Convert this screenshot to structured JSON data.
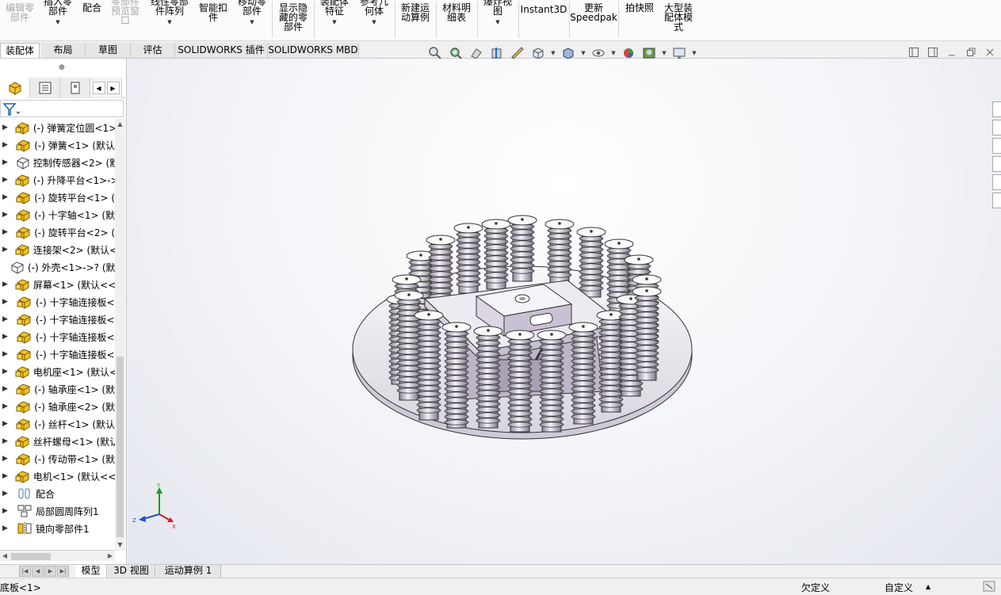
{
  "ribbon": {
    "buttons": [
      {
        "label": "编辑零\n部件",
        "disabled": true
      },
      {
        "label": "插入零\n部件"
      },
      {
        "label": "配合"
      },
      {
        "label": "零部件\n预览窗\n口",
        "disabled": true
      },
      {
        "label": "线性零部\n件阵列"
      },
      {
        "label": "智能扣\n件"
      },
      {
        "label": "移动零\n部件"
      },
      {
        "label": "显示隐\n藏的零\n部件"
      },
      {
        "label": "装配体\n特征"
      },
      {
        "label": "参考几\n何体"
      },
      {
        "label": "新建运\n动算例"
      },
      {
        "label": "材料明\n细表"
      },
      {
        "label": "爆炸视\n图"
      },
      {
        "label": "Instant3D"
      },
      {
        "label": "更新\nSpeedpak"
      },
      {
        "label": "拍快照"
      },
      {
        "label": "大型装\n配体模\n式"
      }
    ]
  },
  "command_tabs": [
    "装配体",
    "布局",
    "草图",
    "评估",
    "SOLIDWORKS 插件",
    "SOLIDWORKS MBD"
  ],
  "feature_tree": {
    "items": [
      {
        "label": "(-) 弹簧定位圆<1>",
        "icon": "part-icon"
      },
      {
        "label": "(-) 弹簧<1> (默认",
        "icon": "part-icon"
      },
      {
        "label": "控制传感器<2> (默",
        "icon": "part-outline-icon"
      },
      {
        "label": "(-) 升降平台<1>->",
        "icon": "part-icon"
      },
      {
        "label": "(-) 旋转平台<1> (",
        "icon": "part-icon"
      },
      {
        "label": "(-) 十字轴<1> (默",
        "icon": "part-icon"
      },
      {
        "label": "(-) 旋转平台<2> (",
        "icon": "part-icon"
      },
      {
        "label": "连接架<2> (默认<",
        "icon": "part-icon"
      },
      {
        "label": "(-) 外壳<1>->? (默",
        "icon": "part-outline-icon"
      },
      {
        "label": "屏幕<1> (默认<<",
        "icon": "part-icon"
      },
      {
        "label": "(-) 十字轴连接板<",
        "icon": "part-icon"
      },
      {
        "label": "(-) 十字轴连接板<",
        "icon": "part-icon"
      },
      {
        "label": "(-) 十字轴连接板<",
        "icon": "part-icon"
      },
      {
        "label": "(-) 十字轴连接板<",
        "icon": "part-icon"
      },
      {
        "label": "电机座<1> (默认<",
        "icon": "part-icon"
      },
      {
        "label": "(-) 轴承座<1> (默",
        "icon": "part-icon"
      },
      {
        "label": "(-) 轴承座<2> (默",
        "icon": "part-icon"
      },
      {
        "label": "(-) 丝杆<1> (默认",
        "icon": "part-icon"
      },
      {
        "label": "丝杆螺母<1> (默认",
        "icon": "part-icon"
      },
      {
        "label": "(-) 传动带<1> (默",
        "icon": "part-icon"
      },
      {
        "label": "电机<1> (默认<<",
        "icon": "part-icon"
      },
      {
        "label": "配合",
        "icon": "mates-icon"
      },
      {
        "label": "局部圆周阵列1",
        "icon": "pattern-icon"
      },
      {
        "label": "镜向零部件1",
        "icon": "mirror-icon"
      }
    ]
  },
  "triad": {
    "x": "X",
    "y": "Y",
    "z": "Z"
  },
  "bottom_tabs": [
    "模型",
    "3D 视图",
    "运动算例 1"
  ],
  "status": {
    "left": "底板<1>",
    "definition": "欠定义",
    "custom": "自定义"
  }
}
